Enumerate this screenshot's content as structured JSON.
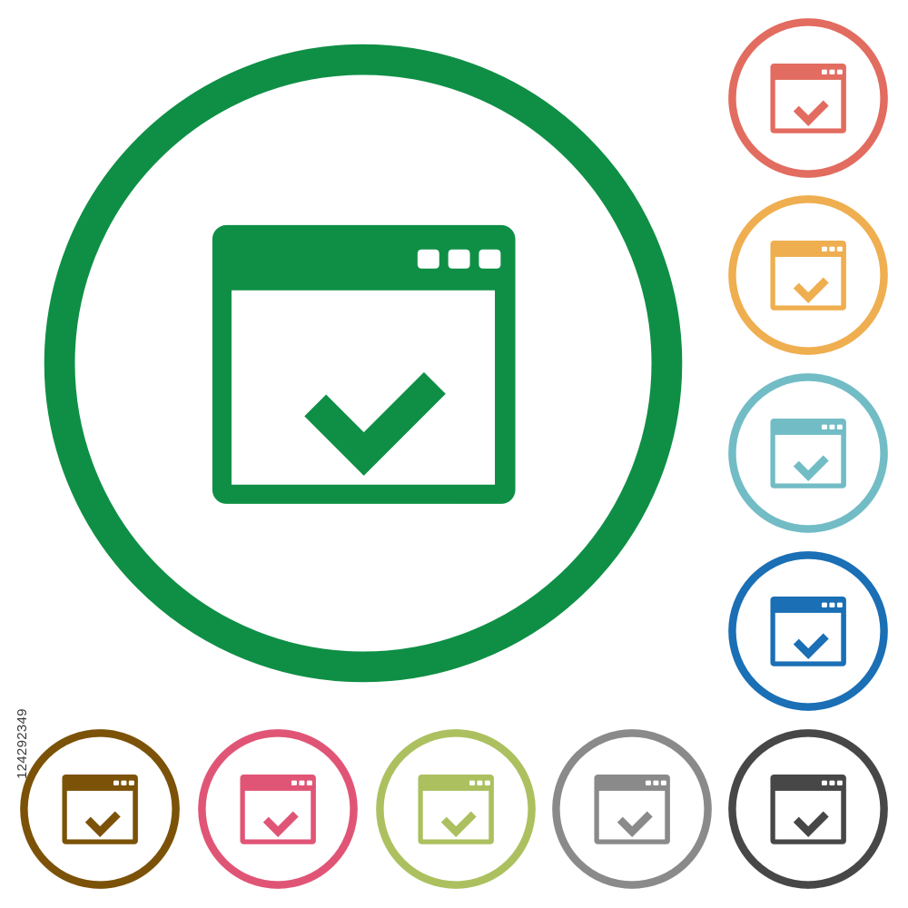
{
  "stock_id": "124292349",
  "icons": {
    "main": {
      "name": "application-ok-icon",
      "color": "#0e8f45"
    },
    "red": {
      "name": "application-ok-icon",
      "color": "#e26c5f"
    },
    "orange": {
      "name": "application-ok-icon",
      "color": "#efae4f"
    },
    "teal": {
      "name": "application-ok-icon",
      "color": "#72bcc6"
    },
    "blue": {
      "name": "application-ok-icon",
      "color": "#1a6fb5"
    },
    "brown": {
      "name": "application-ok-icon",
      "color": "#7b5208"
    },
    "pink": {
      "name": "application-ok-icon",
      "color": "#e05576"
    },
    "olive": {
      "name": "application-ok-icon",
      "color": "#acc05f"
    },
    "gray": {
      "name": "application-ok-icon",
      "color": "#8a8a8a"
    },
    "dark": {
      "name": "application-ok-icon",
      "color": "#474747"
    }
  }
}
